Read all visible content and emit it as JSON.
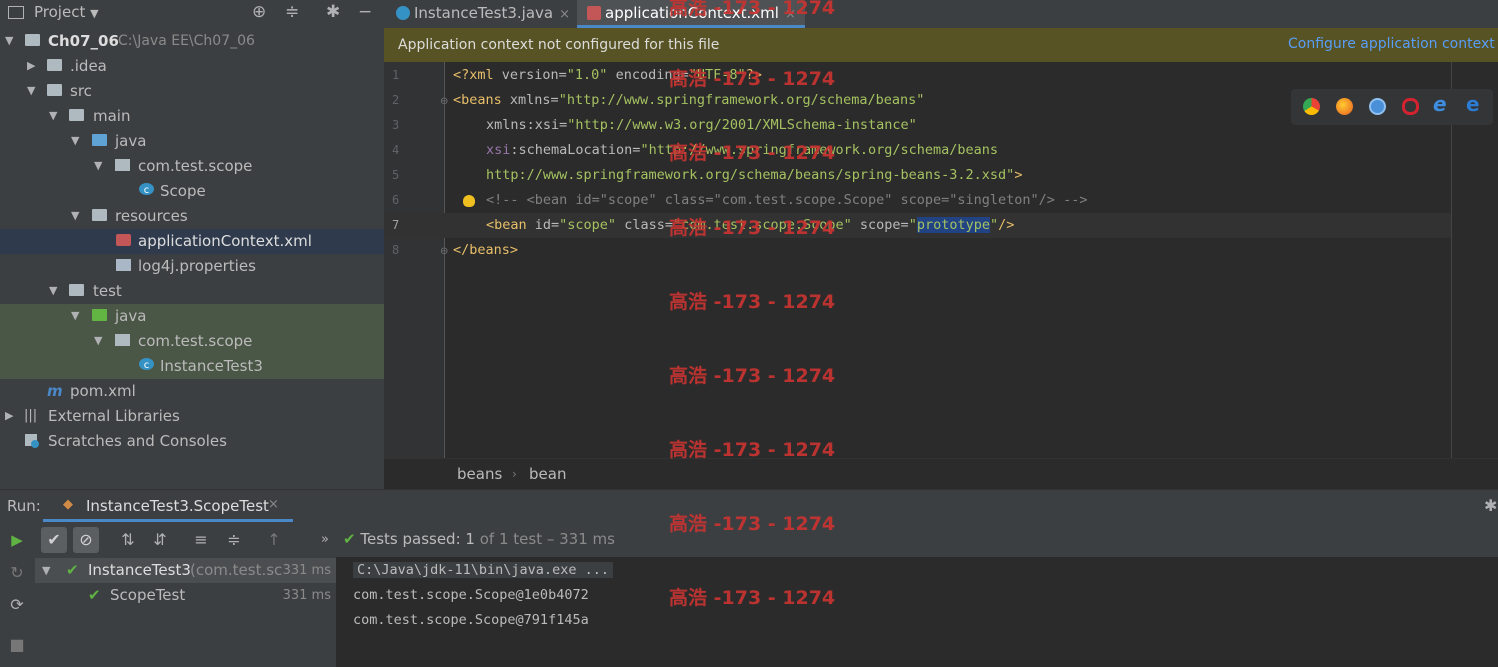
{
  "project": {
    "title": "Project",
    "tree": [
      {
        "label": "Ch07_06",
        "path": "C:\\Java EE\\Ch07_06",
        "depth": 0,
        "arrow": "▼",
        "icon": "folder"
      },
      {
        "label": ".idea",
        "depth": 1,
        "arrow": "▶",
        "icon": "folder"
      },
      {
        "label": "src",
        "depth": 1,
        "arrow": "▼",
        "icon": "folder"
      },
      {
        "label": "main",
        "depth": 2,
        "arrow": "▼",
        "icon": "folder"
      },
      {
        "label": "java",
        "depth": 3,
        "arrow": "▼",
        "icon": "folder-src"
      },
      {
        "label": "com.test.scope",
        "depth": 4,
        "arrow": "▼",
        "icon": "package"
      },
      {
        "label": "Scope",
        "depth": 5,
        "arrow": "",
        "icon": "class"
      },
      {
        "label": "resources",
        "depth": 3,
        "arrow": "▼",
        "icon": "folder"
      },
      {
        "label": "applicationContext.xml",
        "depth": 4,
        "arrow": "",
        "icon": "xml",
        "selected": true
      },
      {
        "label": "log4j.properties",
        "depth": 4,
        "arrow": "",
        "icon": "properties"
      },
      {
        "label": "test",
        "depth": 2,
        "arrow": "▼",
        "icon": "folder"
      },
      {
        "label": "java",
        "depth": 3,
        "arrow": "▼",
        "icon": "folder-test",
        "highlight": true
      },
      {
        "label": "com.test.scope",
        "depth": 4,
        "arrow": "▼",
        "icon": "package",
        "highlight": true
      },
      {
        "label": "InstanceTest3",
        "depth": 5,
        "arrow": "",
        "icon": "class",
        "highlight": true
      },
      {
        "label": "pom.xml",
        "depth": 1,
        "arrow": "",
        "icon": "maven"
      },
      {
        "label": "External Libraries",
        "depth": 0,
        "arrow": "▶",
        "icon": "library"
      },
      {
        "label": "Scratches and Consoles",
        "depth": 0,
        "arrow": "",
        "icon": "scratches"
      }
    ]
  },
  "editor": {
    "tabs": [
      {
        "label": "InstanceTest3.java",
        "active": false
      },
      {
        "label": "applicationContext.xml",
        "active": true
      }
    ],
    "banner_message": "Application context not configured for this file",
    "banner_link": "Configure application context",
    "line_numbers": [
      "1",
      "2",
      "3",
      "4",
      "5",
      "6",
      "7",
      "8"
    ],
    "code": {
      "l1_tag": "<?xml",
      "l1_a1": " version=",
      "l1_v1": "\"1.0\"",
      "l1_a2": " encoding=",
      "l1_v2": "\"UTF-8\"",
      "l1_end": "?>",
      "l2_tag": "<beans",
      "l2_a1": " xmlns=",
      "l2_v1": "\"http://www.springframework.org/schema/beans\"",
      "l3_ns": "xmlns:xsi",
      "l3_eq": "=",
      "l3_v1": "\"http://www.w3.org/2001/XMLSchema-instance\"",
      "l4_ns": "xsi",
      "l4_a": ":schemaLocation=",
      "l4_v1": "\"http://www.springframework.org/schema/beans",
      "l5_v1": "http://www.springframework.org/schema/beans/spring-beans-3.2.xsd\"",
      "l5_end": ">",
      "l6_comment": "<!-- <bean id=\"scope\" class=\"com.test.scope.Scope\" scope=\"singleton\"/> -->",
      "l7_tag": "<bean",
      "l7_a1": " id=",
      "l7_v1": "\"scope\"",
      "l7_a2": " class=",
      "l7_v2": "\"com.test.scope.Scope\"",
      "l7_a3": " scope=",
      "l7_q1": "\"",
      "l7_sel": "prototype",
      "l7_q2": "\"",
      "l7_end": "/>",
      "l8_tag": "</beans>"
    },
    "breadcrumb": [
      "beans",
      "bean"
    ]
  },
  "run": {
    "label": "Run:",
    "tab_label": "InstanceTest3.ScopeTest",
    "status_prefix": "Tests passed:",
    "status_count": "1",
    "status_rest": "of 1 test – 331 ms",
    "results": [
      {
        "name": "InstanceTest3",
        "detail": "(com.test.sco",
        "duration": "331 ms"
      },
      {
        "name": "ScopeTest",
        "detail": "",
        "duration": "331 ms"
      }
    ],
    "console": [
      "C:\\Java\\jdk-11\\bin\\java.exe ...",
      "com.test.scope.Scope@1e0b4072",
      "com.test.scope.Scope@791f145a"
    ]
  },
  "watermark": "高浩 -173 - 1274",
  "colors": {
    "accent": "#4a88c7",
    "banner_bg": "#575324",
    "pass_green": "#5fb343",
    "watermark": "#c83432"
  }
}
